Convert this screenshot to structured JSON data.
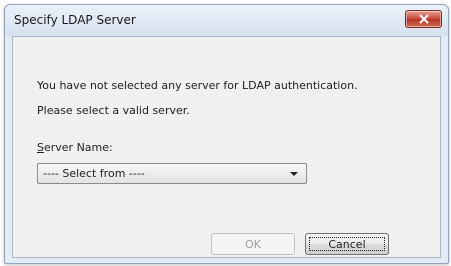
{
  "window": {
    "title": "Specify LDAP Server"
  },
  "message": {
    "line1": "You have not selected any server for LDAP authentication.",
    "line2": "Please select a valid server."
  },
  "server": {
    "label_accel": "S",
    "label_rest": "erver Name:",
    "selected": "---- Select from ----"
  },
  "buttons": {
    "ok": "OK",
    "cancel": "Cancel"
  },
  "icons": {
    "close": "close-icon",
    "dropdown": "chevron-down-icon"
  },
  "colors": {
    "close_button": "#c8473a",
    "dialog_background": "#f0f0f0",
    "frame": "#e3ebf5"
  }
}
